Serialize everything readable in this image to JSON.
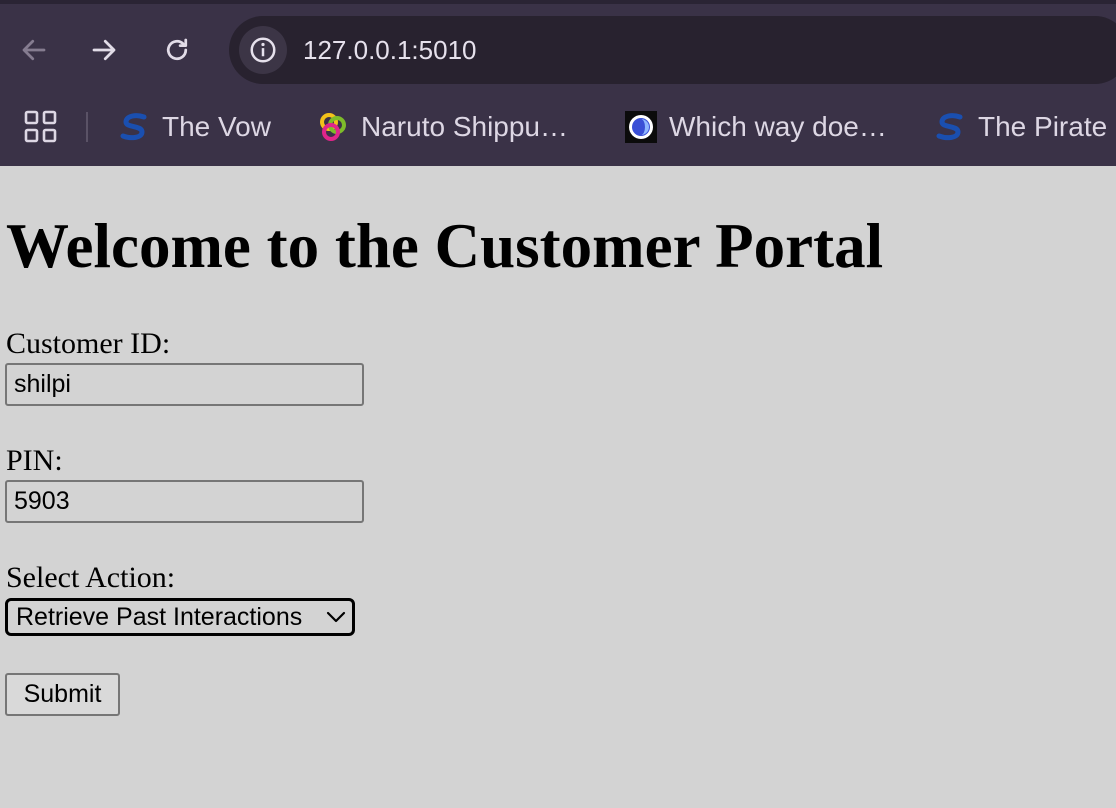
{
  "browser": {
    "url": "127.0.0.1:5010",
    "bookmarks": [
      {
        "label": "The Vow",
        "icon": "s-logo-icon"
      },
      {
        "label": "Naruto Shippu…",
        "icon": "rings-logo-icon"
      },
      {
        "label": "Which way doe…",
        "icon": "globe-logo-icon"
      },
      {
        "label": "The Pirate",
        "icon": "s-logo-icon"
      }
    ],
    "colors": {
      "chrome_bg": "#3a3247",
      "omnibox_bg": "#28222f"
    }
  },
  "page": {
    "background": "#d3d3d3",
    "heading": "Welcome to the Customer Portal",
    "form": {
      "customer_id_label": "Customer ID:",
      "customer_id_value": "shilpi",
      "pin_label": "PIN:",
      "pin_value": "5903",
      "action_label": "Select Action:",
      "action_selected": "Retrieve Past Interactions",
      "submit_label": "Submit"
    }
  }
}
